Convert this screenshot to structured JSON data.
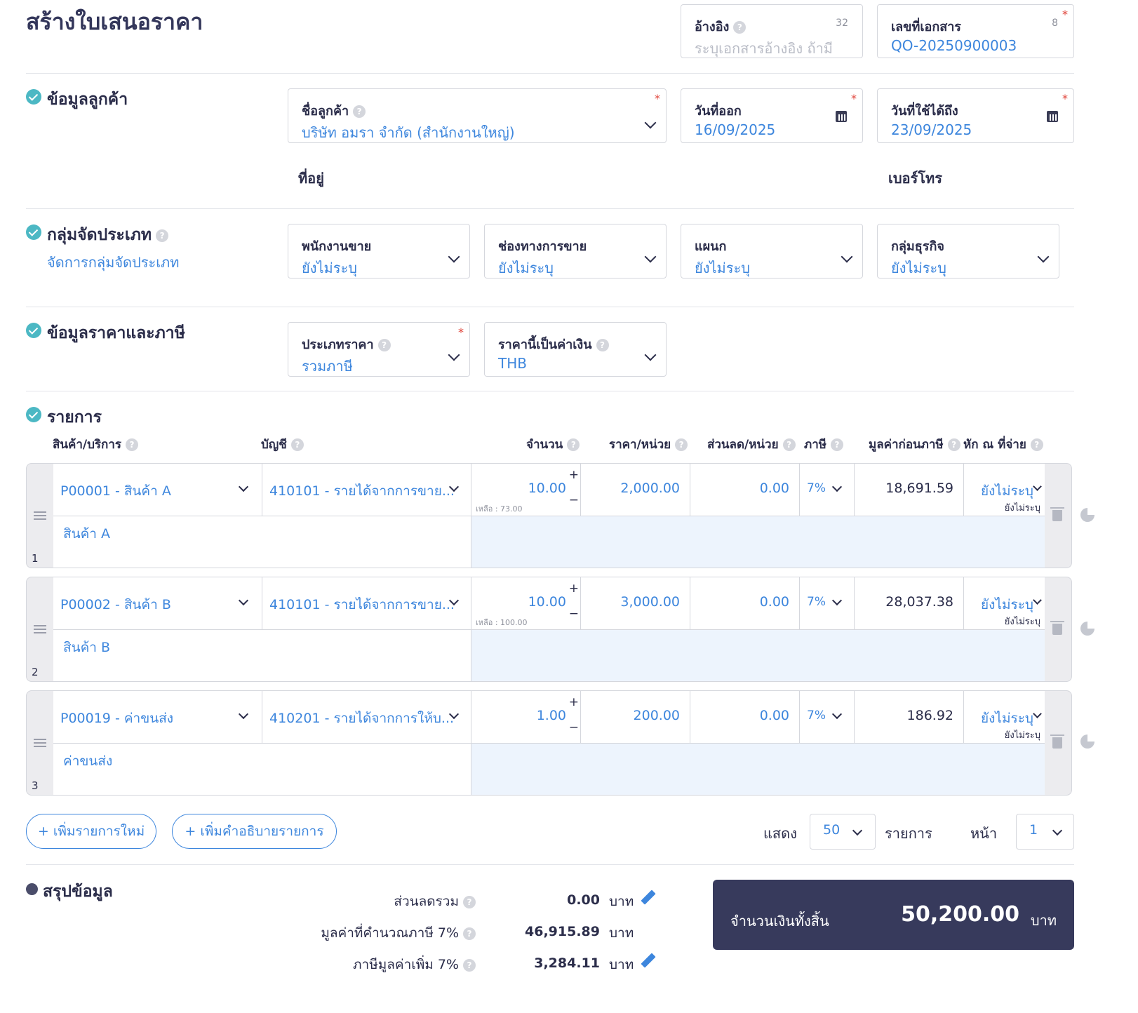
{
  "page_title": "สร้างใบเสนอราคา",
  "reference": {
    "label": "อ้างอิง",
    "placeholder": "ระบุเอกสารอ้างอิง ถ้ามี",
    "counter": "32"
  },
  "doc_number": {
    "label": "เลขที่เอกสาร",
    "value": "QO-20250900003",
    "counter": "8"
  },
  "customer_section": {
    "title": "ข้อมูลลูกค้า",
    "customer_label": "ชื่อลูกค้า",
    "customer_value": "บริษัท อมรา จำกัด (สำนักงานใหญ่)",
    "issue_date_label": "วันที่ออก",
    "issue_date": "16/09/2025",
    "valid_until_label": "วันที่ใช้ได้ถึง",
    "valid_until": "23/09/2025",
    "address_label": "ที่อยู่",
    "phone_label": "เบอร์โทร"
  },
  "group_section": {
    "title": "กลุ่มจัดประเภท",
    "manage_link": "จัดการกลุ่มจัดประเภท",
    "fields": [
      {
        "label": "พนักงานขาย",
        "value": "ยังไม่ระบุ"
      },
      {
        "label": "ช่องทางการขาย",
        "value": "ยังไม่ระบุ"
      },
      {
        "label": "แผนก",
        "value": "ยังไม่ระบุ"
      },
      {
        "label": "กลุ่มธุรกิจ",
        "value": "ยังไม่ระบุ"
      }
    ]
  },
  "price_section": {
    "title": "ข้อมูลราคาและภาษี",
    "price_type_label": "ประเภทราคา",
    "price_type_value": "รวมภาษี",
    "currency_label": "ราคานี้เป็นค่าเงิน",
    "currency_value": "THB"
  },
  "items_section": {
    "title": "รายการ",
    "columns": {
      "product": "สินค้า/บริการ",
      "account": "บัญชี",
      "qty": "จำนวน",
      "unit_price": "ราคา/หน่วย",
      "discount": "ส่วนลด/หน่วย",
      "tax": "ภาษี",
      "pretax": "มูลค่าก่อนภาษี",
      "wht": "หัก ณ ที่จ่าย"
    },
    "rows": [
      {
        "no": "1",
        "product": "P00001 - สินค้า A",
        "account": "410101 - รายได้จากการขาย...",
        "qty": "10.00",
        "remaining": "เหลือ : 73.00",
        "unit_price": "2,000.00",
        "discount": "0.00",
        "tax": "7%",
        "pretax": "18,691.59",
        "wht": "ยังไม่ระบุ",
        "wht_sub": "ยังไม่ระบุ",
        "description": "สินค้า A"
      },
      {
        "no": "2",
        "product": "P00002 - สินค้า B",
        "account": "410101 - รายได้จากการขาย...",
        "qty": "10.00",
        "remaining": "เหลือ : 100.00",
        "unit_price": "3,000.00",
        "discount": "0.00",
        "tax": "7%",
        "pretax": "28,037.38",
        "wht": "ยังไม่ระบุ",
        "wht_sub": "ยังไม่ระบุ",
        "description": "สินค้า B"
      },
      {
        "no": "3",
        "product": "P00019 - ค่าขนส่ง",
        "account": "410201 - รายได้จากการให้บ...",
        "qty": "1.00",
        "remaining": "",
        "unit_price": "200.00",
        "discount": "0.00",
        "tax": "7%",
        "pretax": "186.92",
        "wht": "ยังไม่ระบุ",
        "wht_sub": "ยังไม่ระบุ",
        "description": "ค่าขนส่ง"
      }
    ],
    "add_item": "+ เพิ่มรายการใหม่",
    "add_desc": "+ เพิ่มคำอธิบายรายการ",
    "show_label": "แสดง",
    "show_value": "50",
    "items_label": "รายการ",
    "page_label": "หน้า",
    "page_value": "1"
  },
  "summary": {
    "title": "สรุปข้อมูล",
    "discount_label": "ส่วนลดรวม",
    "discount_value": "0.00",
    "taxable_label": "มูลค่าที่คำนวณภาษี 7%",
    "taxable_value": "46,915.89",
    "vat_label": "ภาษีมูลค่าเพิ่ม 7%",
    "vat_value": "3,284.11",
    "currency_unit": "บาท",
    "total_label": "จำนวนเงินทั้งสิ้น",
    "total_value": "50,200.00"
  },
  "colors": {
    "accent": "#3d86dd",
    "check": "#4cb8c4",
    "total_bg": "#373a5c",
    "text": "#2b2d4a"
  }
}
